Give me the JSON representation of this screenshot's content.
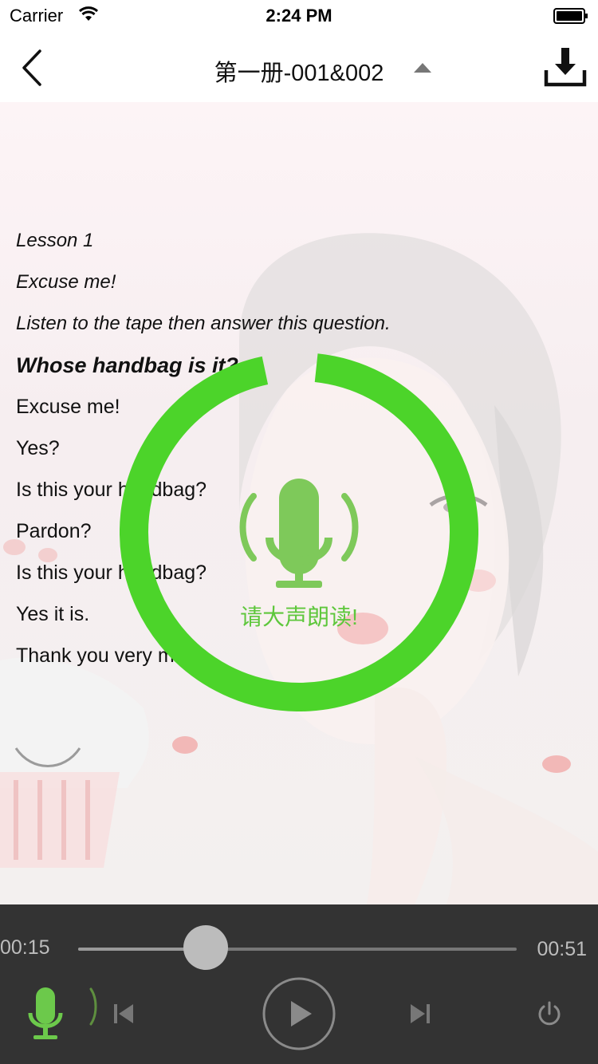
{
  "status_bar": {
    "carrier": "Carrier",
    "time": "2:24 PM"
  },
  "nav": {
    "title": "第一册-001&002"
  },
  "lesson": {
    "lines": [
      "Lesson 1",
      "Excuse me!",
      "Listen to the tape then answer this question.",
      "Whose handbag is it?",
      "Excuse me!",
      "Yes?",
      "Is this your handbag?",
      "Pardon?",
      "Is this your handbag?",
      "Yes it is.",
      "Thank you very much."
    ]
  },
  "recording": {
    "prompt": "请大声朗读!",
    "progress": 0.95
  },
  "player": {
    "elapsed": "00:15",
    "total": "00:51",
    "progress": 0.29
  },
  "colors": {
    "accent": "#4cd42a",
    "mic": "#7ec95a",
    "player_bg": "#333333"
  }
}
